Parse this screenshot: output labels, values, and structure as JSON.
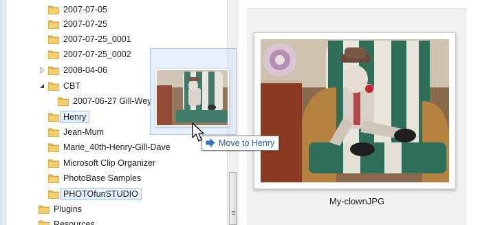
{
  "tree": {
    "items": [
      {
        "label": "2007-07-05",
        "level": 1
      },
      {
        "label": "2007-07-25",
        "level": 1
      },
      {
        "label": "2007-07-25_0001",
        "level": 1
      },
      {
        "label": "2007-07-25_0002",
        "level": 1
      },
      {
        "label": "2008-04-06",
        "level": 1,
        "expander": "collapsed"
      },
      {
        "label": "CBT",
        "level": 1,
        "expander": "expanded"
      },
      {
        "label": "2007-06-27 Gill-Wey",
        "level": 2
      },
      {
        "label": "Henry",
        "level": 1,
        "state": "drop-target"
      },
      {
        "label": "Jean-Mum",
        "level": 1
      },
      {
        "label": "Marie_40th-Henry-Gill-Dave",
        "level": 1
      },
      {
        "label": "Microsoft Clip Organizer",
        "level": 1
      },
      {
        "label": "PhotoBase Samples",
        "level": 1
      },
      {
        "label": "PHOTOfunSTUDIO",
        "level": 1,
        "state": "selected"
      },
      {
        "label": "Plugins",
        "level": 0
      },
      {
        "label": "Resources",
        "level": 0
      }
    ]
  },
  "content": {
    "file_name": "My-clownJPG"
  },
  "drag": {
    "tooltip": "Move to Henry"
  },
  "icons": {
    "folder": "folder-icon",
    "expand": "expand-arrow-icon",
    "collapse": "collapse-arrow-icon",
    "cursor": "arrow-cursor-icon",
    "move": "move-arrow-icon"
  },
  "colors": {
    "folder": "#e8b84a",
    "selection_border": "#9cc7f1",
    "tooltip_text": "#1a5fa8"
  }
}
